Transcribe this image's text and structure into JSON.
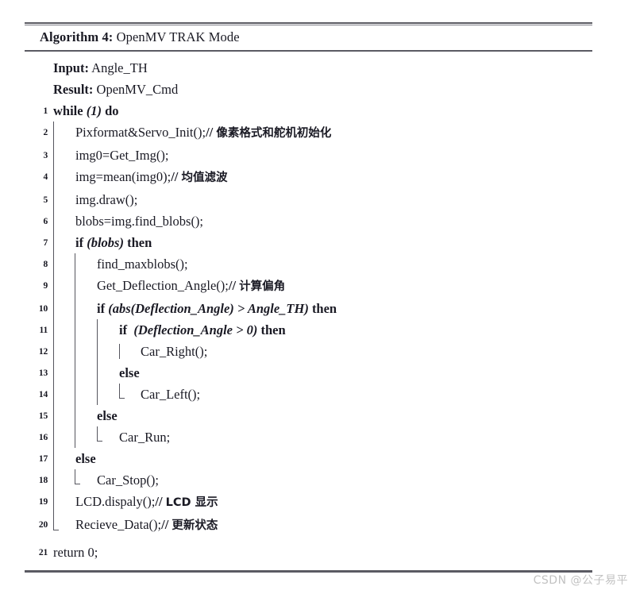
{
  "document": {
    "type": "algorithm-pseudocode",
    "caption_label": "Algorithm 4:",
    "caption_title": "OpenMV TRAK Mode",
    "input_label": "Input:",
    "input_value": "Angle_TH",
    "result_label": "Result:",
    "result_value": "OpenMV_Cmd"
  },
  "lines": [
    {
      "no": "1",
      "text": "while (1) do"
    },
    {
      "no": "2",
      "text": "Pixformat&Servo_Init();// 像素格式和舵机初始化"
    },
    {
      "no": "3",
      "text": "img0=Get_Img();"
    },
    {
      "no": "4",
      "text": "img=mean(img0);// 均值滤波"
    },
    {
      "no": "5",
      "text": "img.draw();"
    },
    {
      "no": "6",
      "text": "blobs=img.find_blobs();"
    },
    {
      "no": "7",
      "text": "if (blobs) then"
    },
    {
      "no": "8",
      "text": "find_maxblobs();"
    },
    {
      "no": "9",
      "text": "Get_Deflection_Angle();// 计算偏角"
    },
    {
      "no": "10",
      "text": "if (abs(Deflection_Angle) > Angle_TH) then"
    },
    {
      "no": "11",
      "text": "if  (Deflection_Angle > 0) then"
    },
    {
      "no": "12",
      "text": "Car_Right();"
    },
    {
      "no": "13",
      "text": "else"
    },
    {
      "no": "14",
      "text": "Car_Left();"
    },
    {
      "no": "15",
      "text": "else"
    },
    {
      "no": "16",
      "text": "Car_Run;"
    },
    {
      "no": "17",
      "text": "else"
    },
    {
      "no": "18",
      "text": "Car_Stop();"
    },
    {
      "no": "19",
      "text": "LCD.dispaly();// LCD 显示"
    },
    {
      "no": "20",
      "text": "Recieve_Data();// 更新状态"
    },
    {
      "no": "21",
      "text": "return 0;"
    }
  ],
  "tokens": {
    "kw_while": "while",
    "paren_1": "(1)",
    "kw_do": "do",
    "l2_call": "Pixformat&Servo_Init();",
    "l2_slashes": "//",
    "l2_comment": "像素格式和舵机初始化",
    "l3_call": "img0=Get_Img();",
    "l4_call": "img=mean(img0);",
    "l4_slashes": "//",
    "l4_comment": "均值滤波",
    "l5_call": "img.draw();",
    "l6_call": "blobs=img.find_blobs();",
    "kw_if": "if",
    "cond_blobs": "(blobs)",
    "kw_then": "then",
    "l8_call": "find_maxblobs();",
    "l9_call": "Get_Deflection_Angle();",
    "l9_slashes": "//",
    "l9_comment": "计算偏角",
    "cond_abs": "(abs(Deflection_Angle) > Angle_TH)",
    "cond_defl": "(Deflection_Angle > 0)",
    "l12_call": "Car_Right();",
    "kw_else": "else",
    "l14_call": "Car_Left();",
    "l16_call": "Car_Run;",
    "l18_call": "Car_Stop();",
    "l19_call": "LCD.dispaly();",
    "l19_slashes": "//",
    "l19_comment": "LCD 显示",
    "l20_call": "Recieve_Data();",
    "l20_slashes": "//",
    "l20_comment": "更新状态",
    "l21_return": "return 0;"
  },
  "watermark": {
    "text": "CSDN @公子易平"
  },
  "colors": {
    "text": "#1a1a24",
    "rule": "#5b5b63",
    "rail": "#55555e",
    "watermark": "#c2c2c2",
    "background": "#ffffff"
  }
}
